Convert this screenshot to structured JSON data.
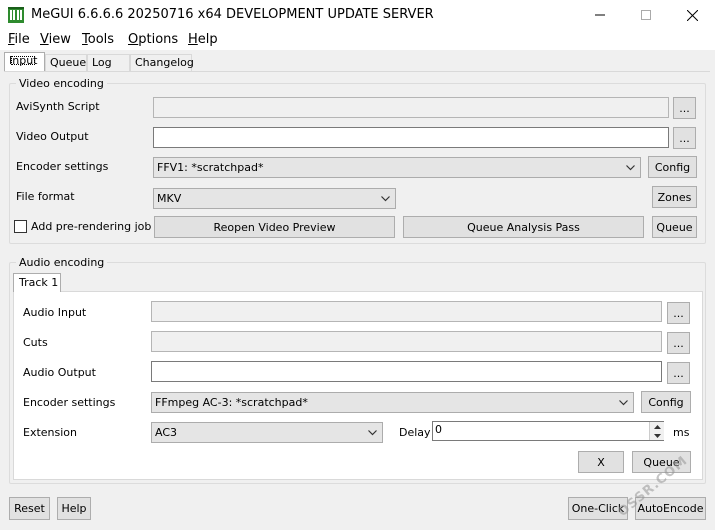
{
  "window": {
    "title": "MeGUI 6.6.6.6 20250716 x64 DEVELOPMENT UPDATE SERVER",
    "icon": "megui-app-icon",
    "controls": {
      "minimize_icon": "minimize-icon",
      "maximize_icon": "maximize-icon",
      "close_icon": "close-icon"
    }
  },
  "menu": {
    "file": {
      "accel": "F",
      "rest": "ile"
    },
    "view": {
      "accel": "V",
      "rest": "iew"
    },
    "tools": {
      "accel": "T",
      "rest": "ools"
    },
    "options": {
      "accel": "O",
      "rest": "ptions"
    },
    "help": {
      "accel": "H",
      "rest": "elp"
    }
  },
  "tabs": [
    "Input",
    "Queue",
    "Log",
    "Changelog"
  ],
  "video": {
    "group_label": "Video encoding",
    "avisynth_label": "AviSynth Script",
    "avisynth_value": "",
    "output_label": "Video Output",
    "output_value": "",
    "encoder_label": "Encoder settings",
    "encoder_value": "FFV1: *scratchpad*",
    "format_label": "File format",
    "format_value": "MKV",
    "prerender_label": "Add pre-rendering job",
    "prerender_checked": false,
    "browse_label": "...",
    "config_label": "Config",
    "zones_label": "Zones",
    "reopen_label": "Reopen Video Preview",
    "analysis_label": "Queue Analysis Pass",
    "queue_label": "Queue"
  },
  "audio": {
    "group_label": "Audio encoding",
    "track_tab": "Track 1",
    "input_label": "Audio Input",
    "input_value": "",
    "cuts_label": "Cuts",
    "cuts_value": "",
    "output_label": "Audio Output",
    "output_value": "",
    "encoder_label": "Encoder settings",
    "encoder_value": "FFmpeg AC-3: *scratchpad*",
    "extension_label": "Extension",
    "extension_value": "AC3",
    "delay_label": "Delay",
    "delay_value": "0",
    "delay_unit": "ms",
    "browse_label": "...",
    "config_label": "Config",
    "x_label": "X",
    "queue_label": "Queue"
  },
  "bottom": {
    "reset_label": "Reset",
    "help_label": "Help",
    "oneclick_label": "One-Click",
    "autoencode_label": "AutoEncode"
  },
  "watermark": "OSSR.COM"
}
